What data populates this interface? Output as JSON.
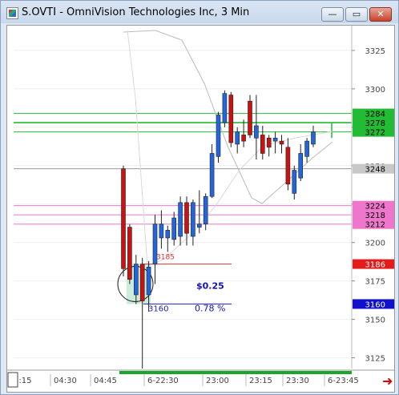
{
  "window": {
    "title": "S.OVTI - OmniVision Technologies Inc, 3 Min",
    "buttons": {
      "minimize": "—",
      "maximize": "▭",
      "close": "✕"
    }
  },
  "chart_data": {
    "type": "candlestick",
    "title": "S.OVTI - OmniVision Technologies Inc, 3 Min",
    "price_ticks": [
      3125,
      3150,
      3175,
      3200,
      3225,
      3250,
      3275,
      3300,
      3325
    ],
    "time_ticks": [
      "4:15",
      "04:30",
      "04:45",
      "6-22:30",
      "23:00",
      "23:15",
      "23:30",
      "6-23:45"
    ],
    "candles": [
      {
        "o": 3248,
        "h": 3250,
        "l": 3178,
        "c": 3183
      },
      {
        "o": 3210,
        "h": 3212,
        "l": 3173,
        "c": 3176
      },
      {
        "o": 3166,
        "h": 3192,
        "l": 3160,
        "c": 3186
      },
      {
        "o": 3186,
        "h": 3190,
        "l": 3118,
        "c": 3162
      },
      {
        "o": 3166,
        "h": 3188,
        "l": 3155,
        "c": 3184
      },
      {
        "o": 3186,
        "h": 3218,
        "l": 3173,
        "c": 3212
      },
      {
        "o": 3203,
        "h": 3221,
        "l": 3196,
        "c": 3212
      },
      {
        "o": 3203,
        "h": 3211,
        "l": 3194,
        "c": 3208
      },
      {
        "o": 3202,
        "h": 3220,
        "l": 3198,
        "c": 3216
      },
      {
        "o": 3204,
        "h": 3230,
        "l": 3198,
        "c": 3226
      },
      {
        "o": 3226,
        "h": 3230,
        "l": 3198,
        "c": 3206
      },
      {
        "o": 3204,
        "h": 3228,
        "l": 3198,
        "c": 3226
      },
      {
        "o": 3210,
        "h": 3234,
        "l": 3206,
        "c": 3212
      },
      {
        "o": 3212,
        "h": 3232,
        "l": 3208,
        "c": 3230
      },
      {
        "o": 3230,
        "h": 3264,
        "l": 3229,
        "c": 3258
      },
      {
        "o": 3256,
        "h": 3285,
        "l": 3252,
        "c": 3283
      },
      {
        "o": 3278,
        "h": 3299,
        "l": 3275,
        "c": 3297
      },
      {
        "o": 3296,
        "h": 3298,
        "l": 3262,
        "c": 3265
      },
      {
        "o": 3264,
        "h": 3275,
        "l": 3258,
        "c": 3272
      },
      {
        "o": 3270,
        "h": 3280,
        "l": 3262,
        "c": 3266
      },
      {
        "o": 3292,
        "h": 3296,
        "l": 3268,
        "c": 3270
      },
      {
        "o": 3268,
        "h": 3296,
        "l": 3254,
        "c": 3276
      },
      {
        "o": 3270,
        "h": 3276,
        "l": 3254,
        "c": 3258
      },
      {
        "o": 3268,
        "h": 3270,
        "l": 3256,
        "c": 3262
      },
      {
        "o": 3266,
        "h": 3272,
        "l": 3258,
        "c": 3268
      },
      {
        "o": 3266,
        "h": 3270,
        "l": 3258,
        "c": 3264
      },
      {
        "o": 3262,
        "h": 3268,
        "l": 3234,
        "c": 3238
      },
      {
        "o": 3232,
        "h": 3250,
        "l": 3228,
        "c": 3247
      },
      {
        "o": 3242,
        "h": 3264,
        "l": 3240,
        "c": 3258
      },
      {
        "o": 3256,
        "h": 3268,
        "l": 3252,
        "c": 3266
      },
      {
        "o": 3264,
        "h": 3276,
        "l": 3262,
        "c": 3272
      }
    ],
    "horizontal_lines": [
      {
        "price": 3284,
        "color": "#22bb33",
        "label": "3284"
      },
      {
        "price": 3278,
        "color": "#22bb33",
        "label": "3278"
      },
      {
        "price": 3272,
        "color": "#22bb33",
        "label": "3272"
      },
      {
        "price": 3248,
        "color": "#999999",
        "label": "3248"
      },
      {
        "price": 3224,
        "color": "#ee77cc",
        "label": "3224"
      },
      {
        "price": 3218,
        "color": "#ee77cc",
        "label": "3218"
      },
      {
        "price": 3212,
        "color": "#ee77cc",
        "label": "3212"
      }
    ],
    "side_badges": [
      {
        "price": 3186,
        "text": "3186",
        "bg": "#e21b1b",
        "fg": "#ffffff"
      },
      {
        "price": 3160,
        "text": "3160",
        "bg": "#1111cc",
        "fg": "#ffffff"
      }
    ],
    "annotations": {
      "hi_label": "3185",
      "lo_label": "3160",
      "change_value": "$0.25",
      "change_pct": "0.78 %"
    },
    "colors": {
      "up": "#2266dd",
      "down": "#cc1111",
      "green_line": "#22bb33",
      "pink_line": "#ee77cc"
    }
  }
}
